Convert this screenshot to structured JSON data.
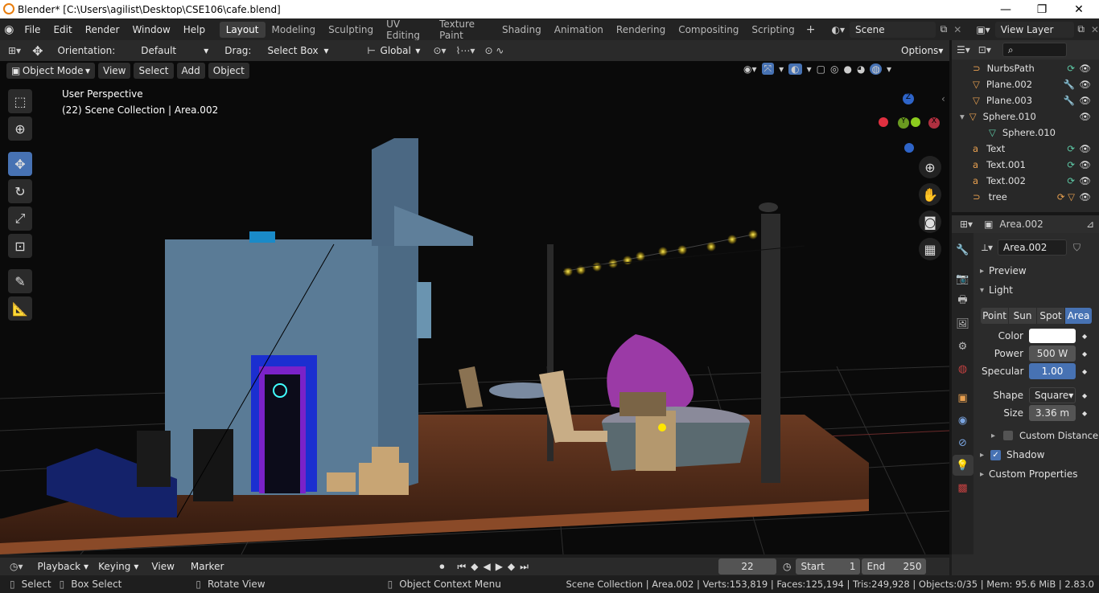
{
  "window": {
    "title": "Blender* [C:\\Users\\agilist\\Desktop\\CSE106\\cafe.blend]",
    "minimize": "—",
    "maximize": "❐",
    "close": "✕"
  },
  "menubar": {
    "file": "File",
    "edit": "Edit",
    "render": "Render",
    "window": "Window",
    "help": "Help"
  },
  "workspaces": [
    "Layout",
    "Modeling",
    "Sculpting",
    "UV Editing",
    "Texture Paint",
    "Shading",
    "Animation",
    "Rendering",
    "Compositing",
    "Scripting"
  ],
  "scene": {
    "name": "Scene",
    "view_layer": "View Layer"
  },
  "tool_header": {
    "orientation_label": "Orientation:",
    "orientation_value": "Default",
    "drag_label": "Drag:",
    "drag_value": "Select Box",
    "transform": "Global",
    "options": "Options"
  },
  "viewport_header": {
    "mode": "Object Mode",
    "view": "View",
    "select": "Select",
    "add": "Add",
    "object": "Object"
  },
  "viewport": {
    "perspective": "User Perspective",
    "collection_info": "(22) Scene Collection | Area.002",
    "gizmo_x": "X",
    "gizmo_y": "Y",
    "gizmo_z": "Z"
  },
  "outliner": {
    "items": [
      {
        "name": "NurbsPath",
        "icon": "curve-icon"
      },
      {
        "name": "Plane.002",
        "icon": "mesh-icon"
      },
      {
        "name": "Plane.003",
        "icon": "mesh-icon"
      },
      {
        "name": "Sphere.010",
        "icon": "mesh-icon"
      },
      {
        "name": "Sphere.010",
        "icon": "mesh-data-icon"
      },
      {
        "name": "Text",
        "icon": "text-icon"
      },
      {
        "name": "Text.001",
        "icon": "text-icon"
      },
      {
        "name": "Text.002",
        "icon": "text-icon"
      },
      {
        "name": "tree",
        "icon": "curve-icon"
      }
    ]
  },
  "properties": {
    "object_name": "Area.002",
    "data_name": "Area.002",
    "preview": "Preview",
    "light": "Light",
    "light_types": [
      "Point",
      "Sun",
      "Spot",
      "Area"
    ],
    "active_type": "Area",
    "color_label": "Color",
    "power_label": "Power",
    "power_value": "500 W",
    "specular_label": "Specular",
    "specular_value": "1.00",
    "shape_label": "Shape",
    "shape_value": "Square",
    "size_label": "Size",
    "size_value": "3.36 m",
    "custom_distance": "Custom Distance",
    "shadow": "Shadow",
    "custom_properties": "Custom Properties",
    "light_color": "#ffffff"
  },
  "timeline": {
    "playback": "Playback",
    "keying": "Keying",
    "view": "View",
    "marker": "Marker",
    "current_frame": "22",
    "start_label": "Start",
    "start_value": "1",
    "end_label": "End",
    "end_value": "250"
  },
  "statusbar": {
    "select": "Select",
    "box_select": "Box Select",
    "rotate_view": "Rotate View",
    "context_menu": "Object Context Menu",
    "stats": "Scene Collection | Area.002 | Verts:153,819 | Faces:125,194 | Tris:249,928 | Objects:0/35 | Mem: 95.6 MiB | 2.83.0"
  },
  "colors": {
    "accent": "#4772b3",
    "active_light": "#5680c2"
  }
}
